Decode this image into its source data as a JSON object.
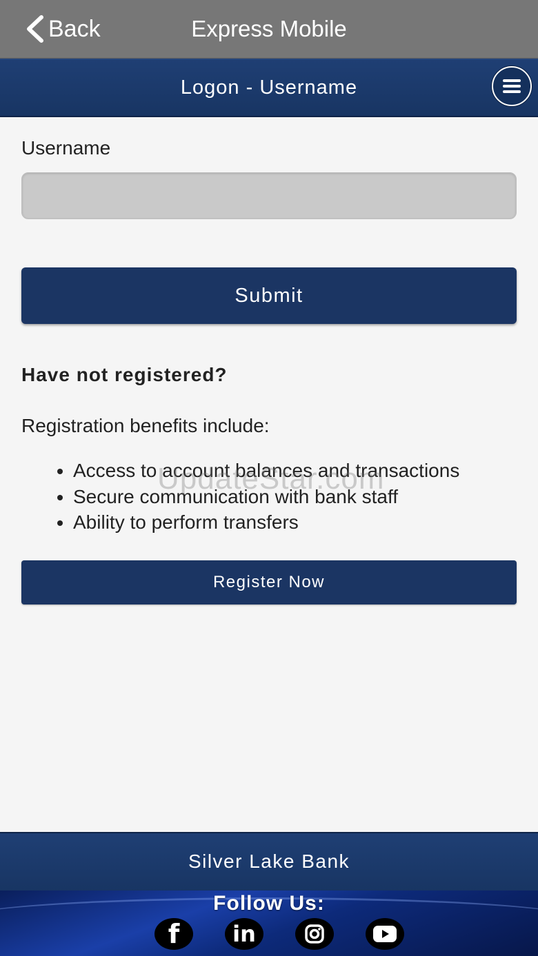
{
  "navbar": {
    "back_label": "Back",
    "title": "Express Mobile"
  },
  "header": {
    "title": "Logon - Username"
  },
  "form": {
    "username_label": "Username",
    "username_value": "",
    "submit_label": "Submit"
  },
  "registration": {
    "heading": "Have not registered?",
    "intro": "Registration benefits include:",
    "benefits": [
      "Access to account balances and transactions",
      "Secure communication with bank staff",
      "Ability to perform transfers"
    ],
    "register_label": "Register Now"
  },
  "watermark": "UpdateStar.com",
  "footer": {
    "bank_name": "Silver Lake Bank",
    "follow_label": "Follow Us:",
    "social": [
      {
        "icon": "facebook-icon",
        "glyph": "f"
      },
      {
        "icon": "linkedin-icon",
        "glyph": "in"
      },
      {
        "icon": "instagram-icon",
        "glyph": ""
      },
      {
        "icon": "youtube-icon",
        "glyph": ""
      }
    ]
  },
  "colors": {
    "navbar": "#777777",
    "brand_navy": "#1b3563",
    "input_bg": "#c9c9c9",
    "page_bg": "#f5f5f5"
  }
}
